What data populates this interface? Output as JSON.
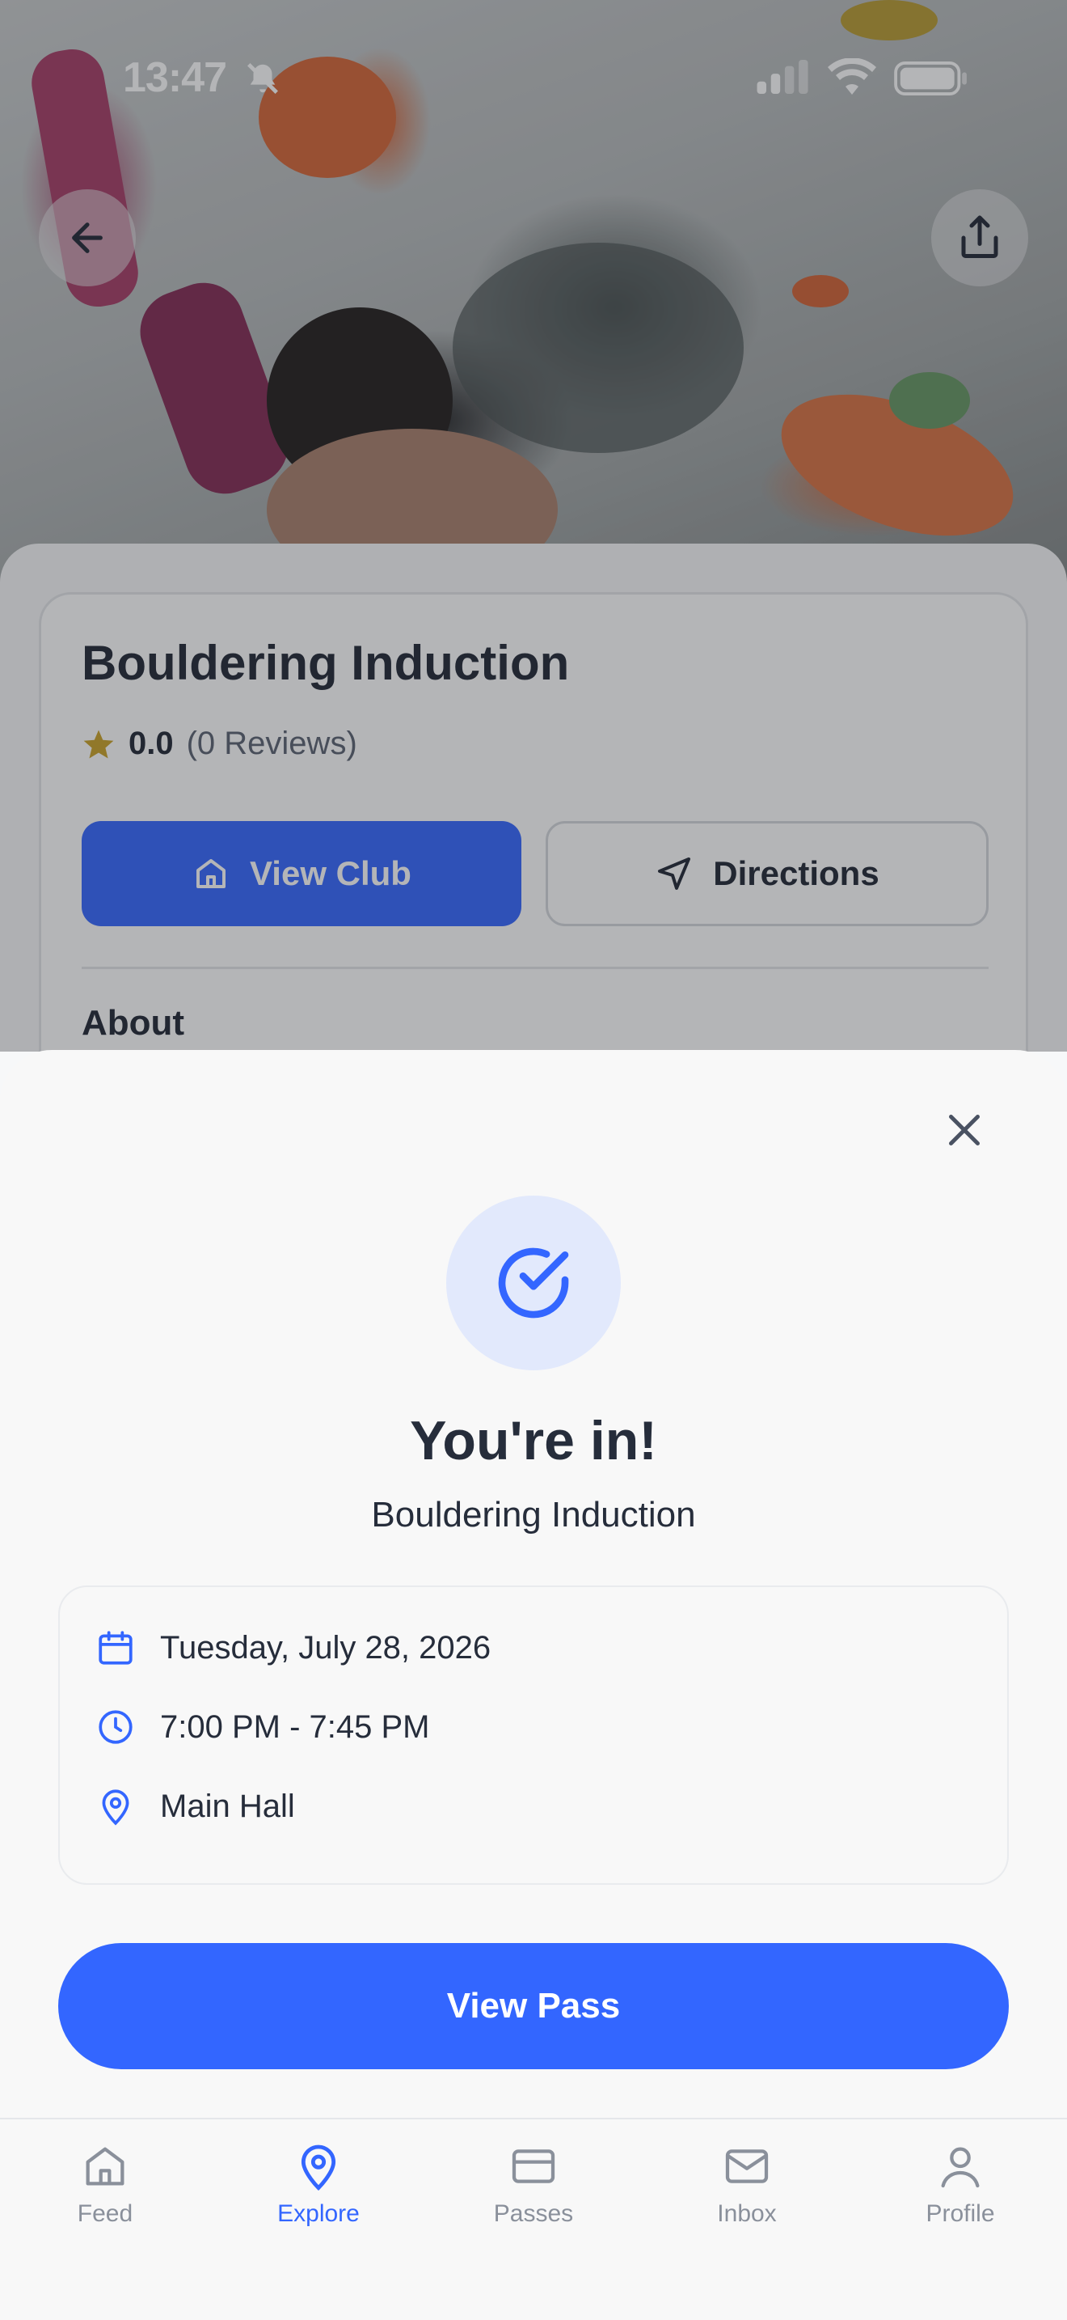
{
  "status_bar": {
    "time": "13:47"
  },
  "event": {
    "title": "Bouldering Induction",
    "rating": "0.0",
    "reviews": "(0 Reviews)",
    "view_club_label": "View Club",
    "directions_label": "Directions",
    "about_label": "About"
  },
  "confirmation": {
    "heading": "You're in!",
    "event_name": "Bouldering Induction",
    "date": "Tuesday, July 28, 2026",
    "time": "7:00 PM - 7:45 PM",
    "location": "Main Hall",
    "view_pass_label": "View Pass"
  },
  "tabbar": {
    "items": [
      {
        "label": "Feed",
        "icon": "home-icon",
        "active": false
      },
      {
        "label": "Explore",
        "icon": "map-pin-icon",
        "active": true
      },
      {
        "label": "Passes",
        "icon": "card-icon",
        "active": false
      },
      {
        "label": "Inbox",
        "icon": "mail-icon",
        "active": false
      },
      {
        "label": "Profile",
        "icon": "user-icon",
        "active": false
      }
    ]
  },
  "colors": {
    "accent": "#3366ff",
    "star": "#c9a227",
    "sheet_bg": "#f8f8f8"
  }
}
